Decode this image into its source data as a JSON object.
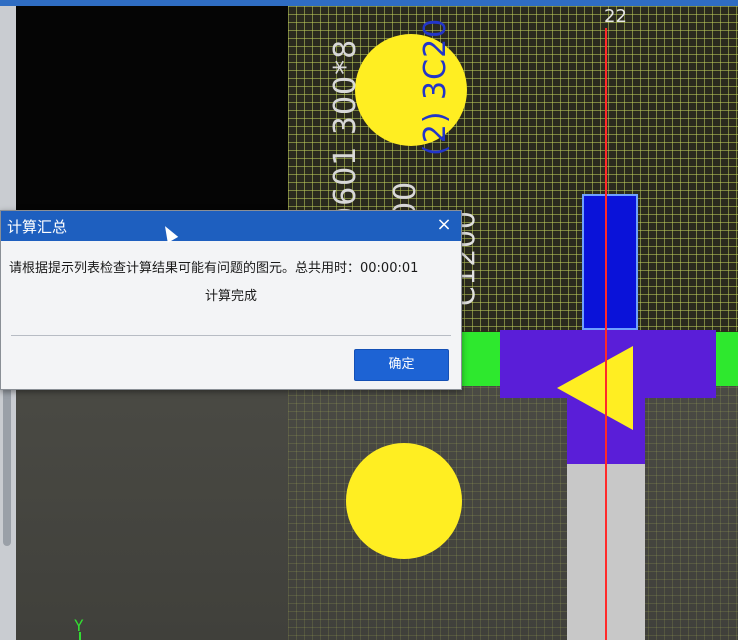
{
  "dialog": {
    "title": "计算汇总",
    "close_glyph": "×",
    "message": "请根据提示列表检查计算结果可能有问题的图元。总共用时：00:00:01",
    "status": "计算完成",
    "ok_label": "确定",
    "colors": {
      "titlebar": "#1e5fbf",
      "ok_button": "#1d63d4"
    }
  },
  "drawing": {
    "axis_number": "22",
    "vertical_texts": [
      "0601 300*8",
      "00",
      "(2) 3C20",
      "C1200"
    ],
    "y_axis_label": "Y",
    "colors": {
      "grid": "#bece5a",
      "yellow": "#ffee22",
      "blue": "#0a12d9",
      "purple": "#5a1ed8",
      "green": "#2ee82e",
      "red": "#ff2a2a"
    }
  }
}
